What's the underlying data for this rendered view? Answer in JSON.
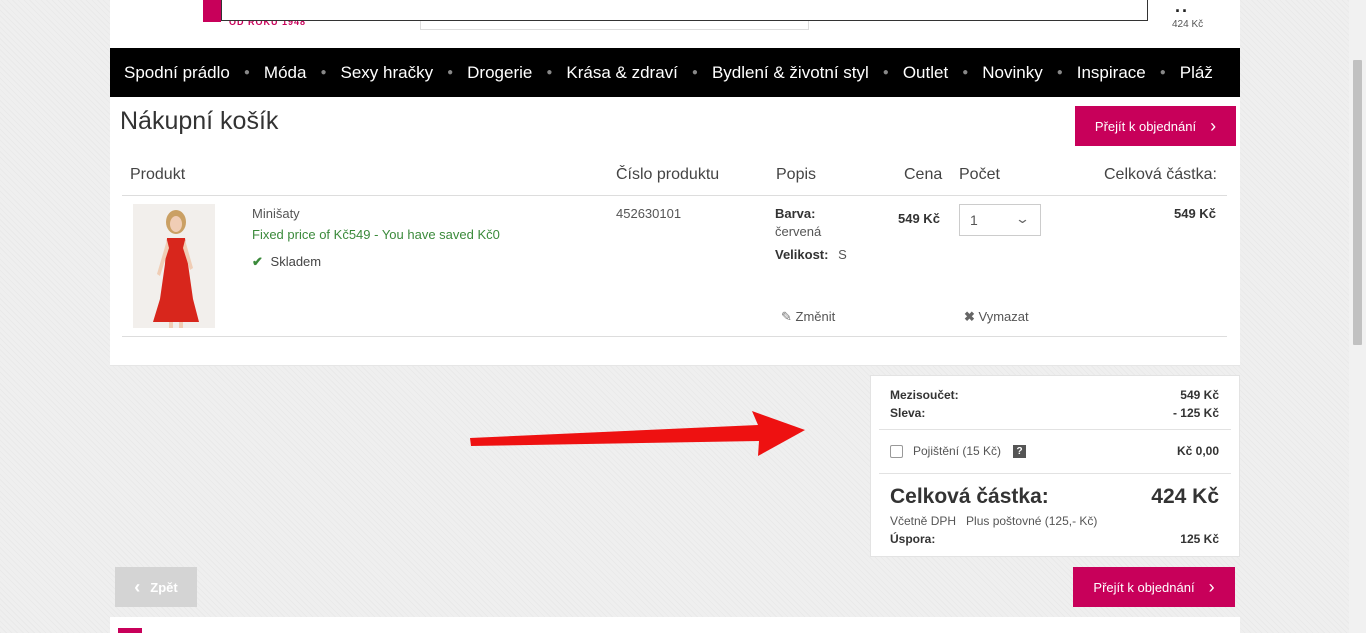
{
  "header": {
    "logo_sub": "OD ROKU 1948",
    "cart_dots": "..",
    "cart_total": "424 Kč"
  },
  "nav": {
    "items": [
      "Spodní prádlo",
      "Móda",
      "Sexy hračky",
      "Drogerie",
      "Krása & zdraví",
      "Bydlení & životní styl",
      "Outlet",
      "Novinky",
      "Inspirace",
      "Pláž"
    ]
  },
  "cart": {
    "title": "Nákupní košík",
    "order_button": "Přejít k objednání",
    "columns": {
      "product": "Produkt",
      "product_number": "Číslo produktu",
      "description": "Popis",
      "price": "Cena",
      "quantity": "Počet",
      "total": "Celková částka:"
    },
    "item": {
      "name": "Minišaty",
      "fixed_price": "Fixed price of Kč549 - You have saved Kč0",
      "stock": "Skladem",
      "number": "452630101",
      "color_label": "Barva:",
      "color_value": "červená",
      "size_label": "Velikost:",
      "size_value": "S",
      "price": "549 Kč",
      "quantity": "1",
      "total": "549 Kč",
      "edit": "Změnit",
      "delete": "Vymazat"
    }
  },
  "summary": {
    "subtotal_label": "Mezisoučet:",
    "subtotal_value": "549 Kč",
    "discount_label": "Sleva:",
    "discount_value": "- 125 Kč",
    "insurance_label": "Pojištění (15 Kč)",
    "insurance_help": "?",
    "insurance_value": "Kč 0,00",
    "total_label": "Celková částka:",
    "total_value": "424 Kč",
    "vat_note": "Včetně DPH",
    "shipping_note": "Plus poštovné (125,- Kč)",
    "saving_label": "Úspora:",
    "saving_value": "125 Kč"
  },
  "footer": {
    "back_button": "Zpět",
    "order_button": "Přejít k objednání"
  },
  "colors": {
    "accent": "#c8005a",
    "nav_bg": "#000000",
    "in_stock": "#3b8a3b",
    "arrow": "#ee1111"
  }
}
